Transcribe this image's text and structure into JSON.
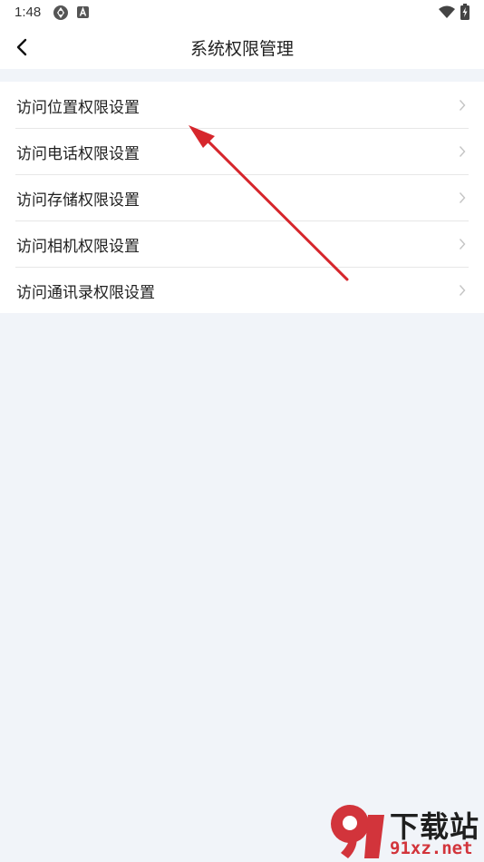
{
  "status_bar": {
    "time": "1:48",
    "icons": [
      "aperture-icon",
      "a-badge-icon",
      "wifi-icon",
      "battery-icon"
    ]
  },
  "header": {
    "back_icon": "back-arrow-icon",
    "title": "系统权限管理"
  },
  "settings": {
    "items": [
      {
        "label": "访问位置权限设置",
        "icon": "chevron-right-icon"
      },
      {
        "label": "访问电话权限设置",
        "icon": "chevron-right-icon"
      },
      {
        "label": "访问存储权限设置",
        "icon": "chevron-right-icon"
      },
      {
        "label": "访问相机权限设置",
        "icon": "chevron-right-icon"
      },
      {
        "label": "访问通讯录权限设置",
        "icon": "chevron-right-icon"
      }
    ]
  },
  "annotation": {
    "color": "#d6262c"
  },
  "watermark": {
    "title": "下载站",
    "domain": "91xz.net",
    "accent": "#d2343b"
  },
  "colors": {
    "background": "#f1f4f9",
    "surface": "#ffffff",
    "divider": "#e7e7e7"
  }
}
